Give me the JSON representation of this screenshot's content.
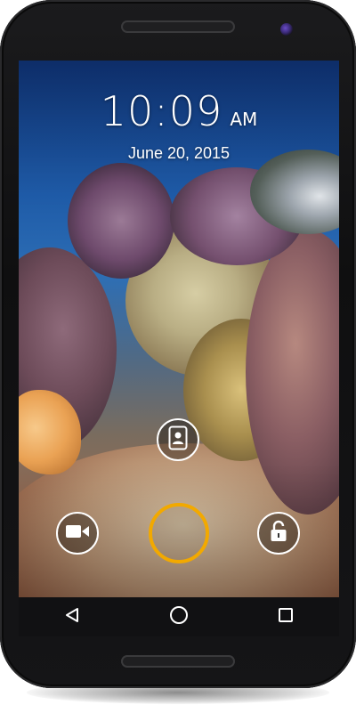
{
  "lock_screen": {
    "time": "10:09",
    "ampm": "AM",
    "date": "June 20, 2015"
  },
  "icons": {
    "contact": "contact-card-icon",
    "video": "video-camera-icon",
    "unlock": "unlock-padlock-icon",
    "back": "back-triangle-icon",
    "home": "home-circle-icon",
    "recents": "recents-square-icon"
  },
  "colors": {
    "accent_ring": "#f2a900",
    "phone_body": "#111113",
    "camera": "#5b3fb5"
  }
}
